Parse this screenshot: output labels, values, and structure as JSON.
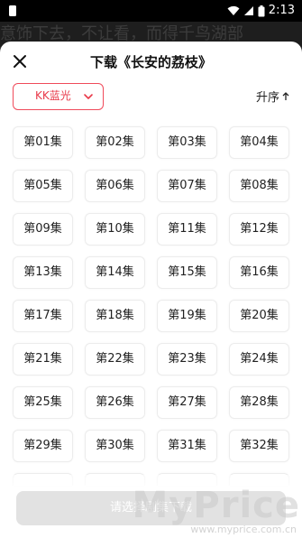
{
  "status_bar": {
    "time": "2:13"
  },
  "backdrop": {
    "text": "意饰下去，不让看，而得千鸟湖部"
  },
  "header": {
    "title": "下载《长安的荔枝》"
  },
  "toolbar": {
    "quality_label": "KK蓝光",
    "sort_label": "升序"
  },
  "episodes": [
    "第01集",
    "第02集",
    "第03集",
    "第04集",
    "第05集",
    "第06集",
    "第07集",
    "第08集",
    "第09集",
    "第10集",
    "第11集",
    "第12集",
    "第13集",
    "第14集",
    "第15集",
    "第16集",
    "第17集",
    "第18集",
    "第19集",
    "第20集",
    "第21集",
    "第22集",
    "第23集",
    "第24集",
    "第25集",
    "第26集",
    "第27集",
    "第28集",
    "第29集",
    "第30集",
    "第31集",
    "第32集"
  ],
  "footer": {
    "confirm_label": "请选择剧集下载"
  },
  "watermark": {
    "brand": "MyPrice",
    "url": "www.myprice.com.cn"
  },
  "colors": {
    "accent": "#f04a5a",
    "button_disabled": "#e2e2e2"
  }
}
